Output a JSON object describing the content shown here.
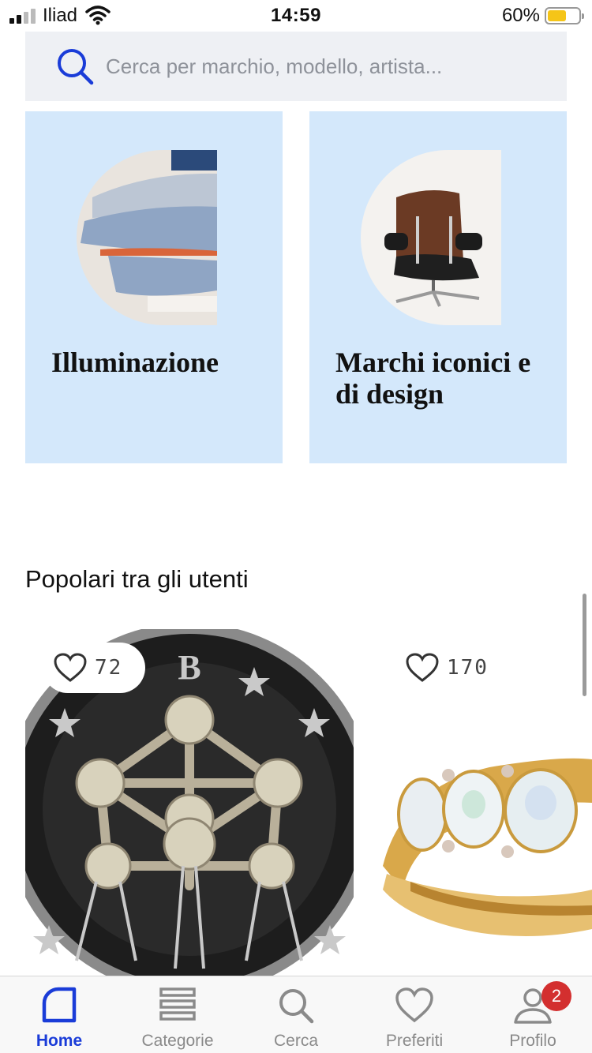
{
  "status_bar": {
    "carrier": "Iliad",
    "time": "14:59",
    "battery": "60%",
    "battery_level": 0.6
  },
  "search": {
    "placeholder": "Cerca per marchio, modello, artista...",
    "icon": "search-icon"
  },
  "categories": [
    {
      "title": "Illuminazione",
      "image": "pendant-lamp"
    },
    {
      "title": "Marchi iconici e di design",
      "image": "lounge-chair"
    }
  ],
  "section": {
    "title": "Popolari tra gli utenti"
  },
  "products": [
    {
      "likes": "72",
      "image": "coin-atomium",
      "icon": "heart-icon"
    },
    {
      "likes": "170",
      "image": "opal-ring",
      "icon": "heart-icon"
    }
  ],
  "tab_bar": {
    "active": "home",
    "items": [
      {
        "label": "Home",
        "icon": "home-icon"
      },
      {
        "label": "Categorie",
        "icon": "categories-icon"
      },
      {
        "label": "Cerca",
        "icon": "search-icon"
      },
      {
        "label": "Preferiti",
        "icon": "heart-icon"
      },
      {
        "label": "Profilo",
        "icon": "profile-icon",
        "badge": "2"
      }
    ]
  },
  "colors": {
    "accent": "#1a3cd8",
    "card_background": "#d4e8fb",
    "search_background": "#eef0f4",
    "badge": "#d32f2f"
  }
}
